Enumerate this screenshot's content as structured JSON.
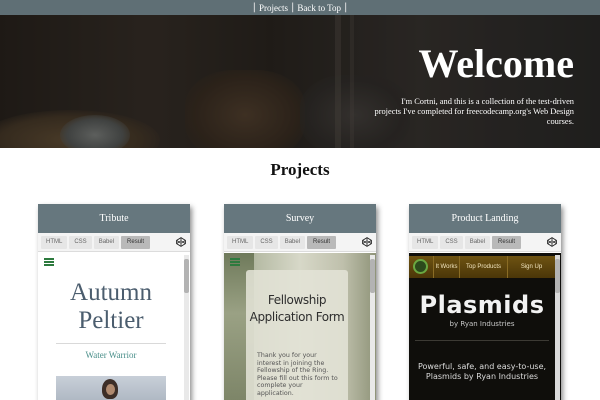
{
  "nav": {
    "links": [
      "Projects",
      "Back to Top"
    ]
  },
  "hero": {
    "title": "Welcome",
    "intro": "I'm Cortni, and this is a collection of the test-driven projects I've completed for freecodecamp.org's Web Design courses."
  },
  "projects": {
    "heading": "Projects",
    "editor_tabs": [
      "HTML",
      "CSS",
      "Babel",
      "Result"
    ],
    "active_tab": "Result",
    "cards": [
      {
        "title": "Tribute",
        "preview": {
          "name": "Autumn Peltier",
          "subtitle": "Water Warrior"
        }
      },
      {
        "title": "Survey",
        "preview": {
          "form_title": "Fellowship Application Form",
          "description": "Thank you for your interest in joining the Fellowship of the Ring. Please fill out this form to complete your application."
        }
      },
      {
        "title": "Product Landing",
        "preview": {
          "nav_links": [
            "It Works",
            "Top Products",
            "Sign Up"
          ],
          "product_name": "Plasmids",
          "byline": "by Ryan Industries",
          "tagline": "Powerful, safe, and easy-to-use, Plasmids by Ryan Industries"
        }
      }
    ]
  },
  "colors": {
    "nav_bg": "#5f6f75",
    "card_header": "#66777e",
    "tribute_name": "#4b5d6e",
    "tribute_subtitle": "#4a8f8a",
    "hamburger": "#2d7a3e",
    "product_nav": "#6e5312"
  },
  "icons": [
    "hamburger-menu-icon",
    "codepen-logo-icon",
    "product-logo-icon"
  ]
}
